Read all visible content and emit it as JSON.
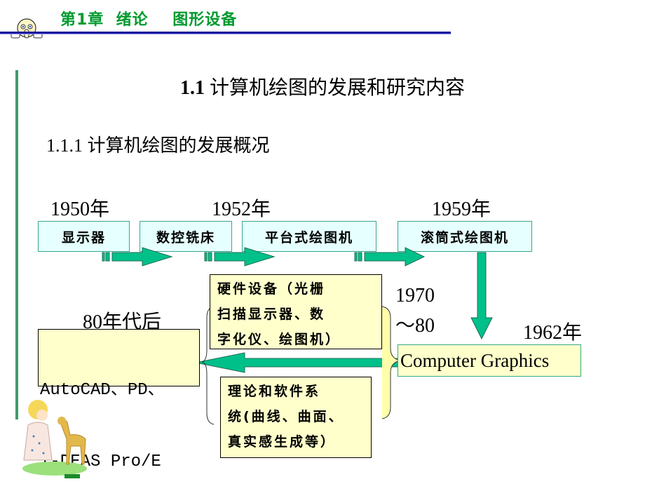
{
  "header": {
    "chapter_title": "第1章  绪论    图形设备",
    "mascot_icon": "peeking-face-icon"
  },
  "titles": {
    "section_number": "1.1",
    "section_text": " 计算机绘图的发展和研究内容",
    "subsection": "1.1.1 计算机绘图的发展概况"
  },
  "timeline": {
    "years": [
      "1950年",
      "1952年",
      "1959年",
      "1962年",
      "1970\n～80",
      "80年代后"
    ],
    "year_1970": "1970",
    "year_1980": "～80",
    "nodes": [
      "显示器",
      "数控铣床",
      "平台式绘图机",
      "滚筒式绘图机"
    ],
    "computer_graphics": "Computer Graphics",
    "hardware_box": [
      "硬件设备（光栅",
      "扫描显示器、数",
      "字化仪、绘图机）"
    ],
    "software_box": [
      "理论和软件系",
      "统(曲线、曲面、",
      "真实感生成等）"
    ],
    "products_box": [
      "AutoCAD、PD、",
      "I-DEAS Pro/E"
    ]
  },
  "colors": {
    "header_green": "#009a2e",
    "rule_blue": "#1a1a9a",
    "arrow_green": "#00c08a",
    "box_cyan": "#e6ffff",
    "box_yellow": "#ffffcc",
    "side_bar_green": "#3f9b6c"
  },
  "decorations": {
    "illustration": "girl-and-deer-illustration"
  }
}
